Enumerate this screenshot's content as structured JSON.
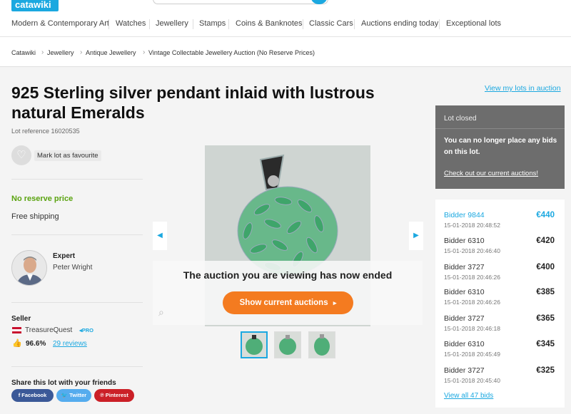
{
  "header": {
    "logo": "catawiki"
  },
  "nav": [
    "Modern & Contemporary Art",
    "Watches",
    "Jewellery",
    "Stamps",
    "Coins & Banknotes",
    "Classic Cars",
    "Auctions ending today",
    "Exceptional lots"
  ],
  "breadcrumb": [
    "Catawiki",
    "Jewellery",
    "Antique Jewellery",
    "Vintage Collectable Jewellery Auction (No Reserve Prices)"
  ],
  "lot": {
    "title_line1": "925 Sterling silver pendant inlaid with lustrous",
    "title_line2": "natural Emeralds",
    "reference": "Lot reference 16020535",
    "favourite_label": "Mark lot as favourite",
    "no_reserve": "No reserve price",
    "shipping": "Free shipping"
  },
  "expert": {
    "heading": "Expert",
    "name": "Peter Wright"
  },
  "seller": {
    "heading": "Seller",
    "name": "TreasureQuest",
    "badge": "PRO",
    "rating": "96.6%",
    "reviews": "29 reviews"
  },
  "share": {
    "heading": "Share this lot with your friends",
    "facebook": "Facebook",
    "twitter": "Twitter",
    "pinterest": "Pinterest"
  },
  "gallery": {
    "ended_text": "The auction you are viewing has now ended",
    "button": "Show current auctions",
    "button_arrow": "▸"
  },
  "sidebar": {
    "my_lots": "View my lots in auction",
    "closed": {
      "heading": "Lot closed",
      "text": "You can no longer place any bids on this lot.",
      "link": "Check out our current auctions!"
    },
    "bids": [
      {
        "bidder": "Bidder 9844",
        "time": "15-01-2018 20:48:52",
        "amount": "€440"
      },
      {
        "bidder": "Bidder 6310",
        "time": "15-01-2018 20:46:40",
        "amount": "€420"
      },
      {
        "bidder": "Bidder 3727",
        "time": "15-01-2018 20:46:26",
        "amount": "€400"
      },
      {
        "bidder": "Bidder 6310",
        "time": "15-01-2018 20:46:26",
        "amount": "€385"
      },
      {
        "bidder": "Bidder 3727",
        "time": "15-01-2018 20:46:18",
        "amount": "€365"
      },
      {
        "bidder": "Bidder 6310",
        "time": "15-01-2018 20:45:49",
        "amount": "€345"
      },
      {
        "bidder": "Bidder 3727",
        "time": "15-01-2018 20:45:40",
        "amount": "€325"
      }
    ],
    "view_all": "View all 47 bids"
  },
  "colors": {
    "brand": "#1ba8e0",
    "accent_orange": "#f47b20",
    "success": "#5aa30f",
    "closed_bg": "#6d6d6d"
  }
}
